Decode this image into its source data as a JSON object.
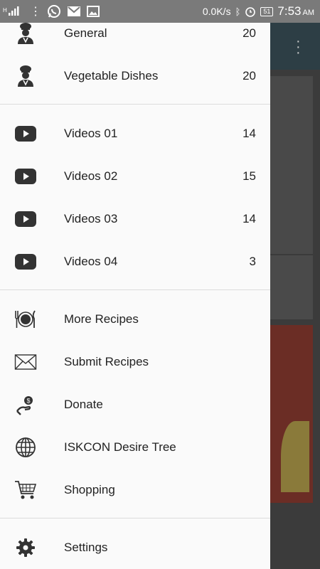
{
  "status_bar": {
    "speed": "0.0K/s",
    "battery": "51",
    "time": "7:53",
    "ampm": "AM"
  },
  "drawer": {
    "categories": [
      {
        "label": "General",
        "count": "20",
        "icon": "chef-icon"
      },
      {
        "label": "Vegetable Dishes",
        "count": "20",
        "icon": "chef-icon"
      }
    ],
    "videos": [
      {
        "label": "Videos 01",
        "count": "14",
        "icon": "youtube-play-icon"
      },
      {
        "label": "Videos 02",
        "count": "15",
        "icon": "youtube-play-icon"
      },
      {
        "label": "Videos 03",
        "count": "14",
        "icon": "youtube-play-icon"
      },
      {
        "label": "Videos 04",
        "count": "3",
        "icon": "youtube-play-icon"
      }
    ],
    "links": [
      {
        "label": "More Recipes",
        "icon": "plate-cutlery-icon"
      },
      {
        "label": "Submit Recipes",
        "icon": "envelope-icon"
      },
      {
        "label": "Donate",
        "icon": "donate-hand-icon"
      },
      {
        "label": "ISKCON Desire Tree",
        "icon": "globe-icon"
      },
      {
        "label": "Shopping",
        "icon": "shopping-cart-icon"
      }
    ],
    "settings": {
      "label": "Settings",
      "icon": "gear-icon"
    }
  }
}
